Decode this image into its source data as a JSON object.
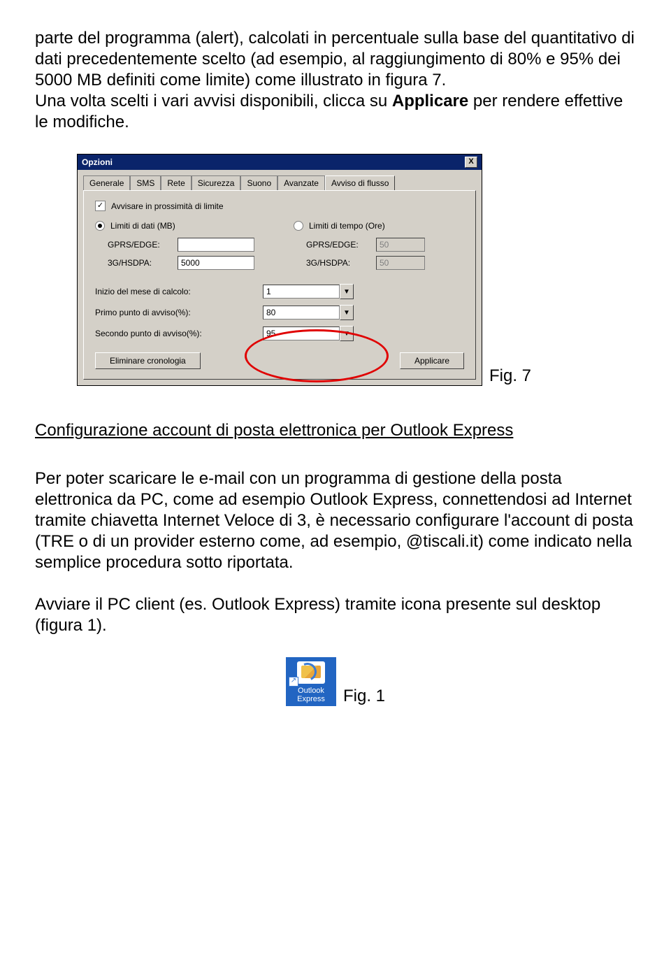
{
  "para1_pre": "parte del programma (alert), calcolati in percentuale sulla base del quantitativo di dati precedentemente scelto (ad esempio, al raggiungimento di 80% e 95% dei 5000 MB definiti come limite) come illustrato in figura 7.",
  "para1_line2a": "Una volta scelti i vari avvisi disponibili, clicca su ",
  "para1_bold": "Applicare",
  "para1_line2b": " per rendere effettive le modifiche.",
  "dialog": {
    "title": "Opzioni",
    "tabs": [
      "Generale",
      "SMS",
      "Rete",
      "Sicurezza",
      "Suono",
      "Avanzate",
      "Avviso di flusso"
    ],
    "active_tab": "Avviso di flusso",
    "checkbox_label": "Avvisare in prossimità di limite",
    "checkbox_checked": "✓",
    "radio_data": "Limiti di dati (MB)",
    "radio_time": "Limiti di tempo (Ore)",
    "gprs_label": "GPRS/EDGE:",
    "hsdpa_label": "3G/HSDPA:",
    "left_gprs_value": "",
    "left_hsdpa_value": "5000",
    "right_gprs_value": "50",
    "right_hsdpa_value": "50",
    "month_start_label": "Inizio del mese di calcolo:",
    "month_start_value": "1",
    "first_warn_label": "Primo punto di avviso(%):",
    "first_warn_value": "80",
    "second_warn_label": "Secondo punto di avviso(%):",
    "second_warn_value": "95",
    "btn_clear": "Eliminare cronologia",
    "btn_apply": "Applicare",
    "close_x": "X"
  },
  "fig7_caption": "Fig. 7",
  "section_heading": "Configurazione account di posta elettronica per Outlook Express",
  "para2": "Per poter scaricare le e-mail con un programma di gestione della posta elettronica da PC, come ad esempio Outlook Express, connettendosi ad Internet tramite chiavetta Internet Veloce di 3, è necessario configurare l'account di posta (TRE o di un provider esterno come, ad esempio, @tiscali.it) come indicato nella semplice procedura sotto riportata.",
  "para3": "Avviare il PC client (es. Outlook Express) tramite icona presente sul desktop (figura 1).",
  "outlook_icon": {
    "line1": "Outlook",
    "line2": "Express",
    "shortcut_arrow": "↗"
  },
  "fig1_caption": "Fig. 1"
}
